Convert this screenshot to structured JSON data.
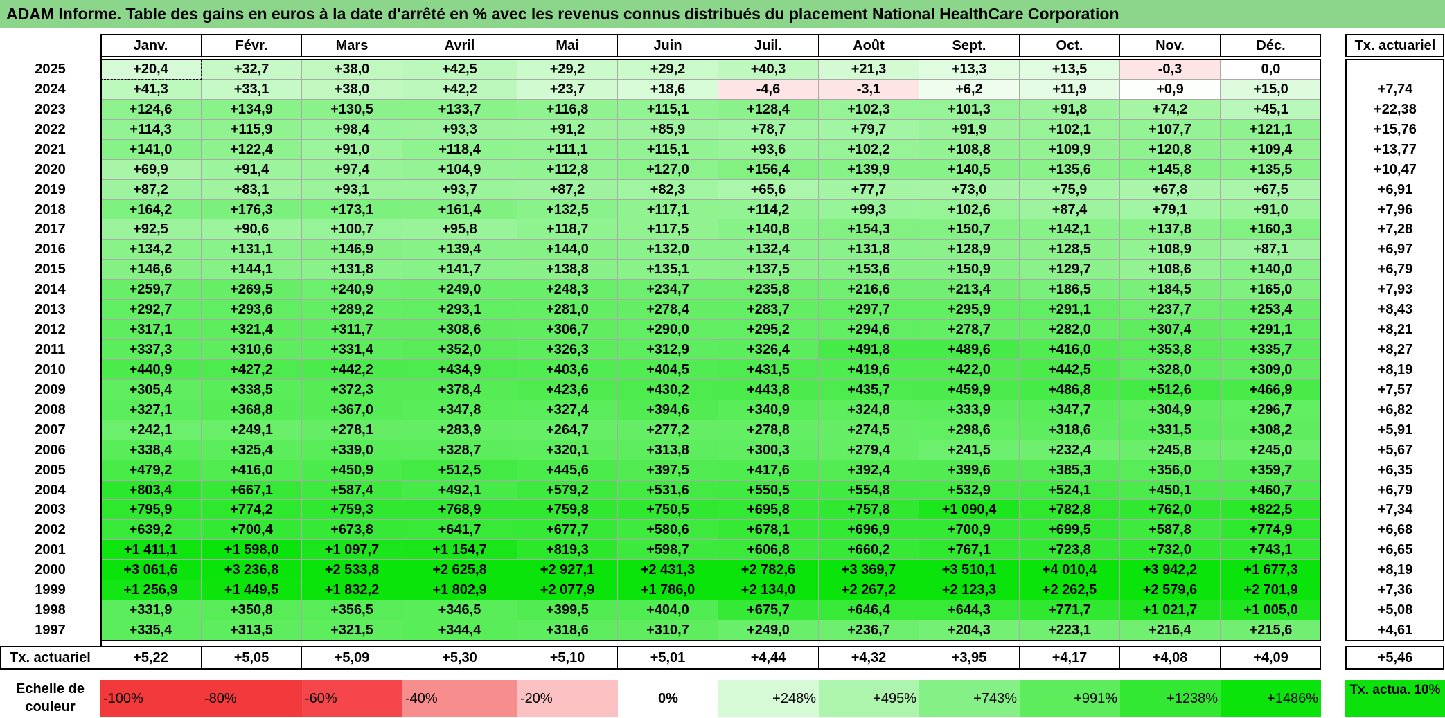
{
  "title": "ADAM Informe. Table des gains en euros à la date d'arrêté en % avec les revenus connus distribués du placement National HealthCare Corporation",
  "chart_data": {
    "type": "heatmap",
    "title": "ADAM Informe. Table des gains en euros à la date d'arrêté en % avec les revenus connus distribués du placement National HealthCare Corporation",
    "columns": [
      "Janv.",
      "Févr.",
      "Mars",
      "Avril",
      "Mai",
      "Juin",
      "Juil.",
      "Août",
      "Sept.",
      "Oct.",
      "Nov.",
      "Déc."
    ],
    "rate_header": "Tx. actuariel",
    "rows": [
      {
        "year": "2025",
        "values": [
          "+20,4",
          "+32,7",
          "+38,0",
          "+42,5",
          "+29,2",
          "+29,2",
          "+40,3",
          "+21,3",
          "+13,3",
          "+13,5",
          "-0,3",
          "0,0"
        ],
        "rate": ""
      },
      {
        "year": "2024",
        "values": [
          "+41,3",
          "+33,1",
          "+38,0",
          "+42,2",
          "+23,7",
          "+18,6",
          "-4,6",
          "-3,1",
          "+6,2",
          "+11,9",
          "+0,9",
          "+15,0"
        ],
        "rate": "+7,74"
      },
      {
        "year": "2023",
        "values": [
          "+124,6",
          "+134,9",
          "+130,5",
          "+133,7",
          "+116,8",
          "+115,1",
          "+128,4",
          "+102,3",
          "+101,3",
          "+91,8",
          "+74,2",
          "+45,1"
        ],
        "rate": "+22,38"
      },
      {
        "year": "2022",
        "values": [
          "+114,3",
          "+115,9",
          "+98,4",
          "+93,3",
          "+91,2",
          "+85,9",
          "+78,7",
          "+79,7",
          "+91,9",
          "+102,1",
          "+107,7",
          "+121,1"
        ],
        "rate": "+15,76"
      },
      {
        "year": "2021",
        "values": [
          "+141,0",
          "+122,4",
          "+91,0",
          "+118,4",
          "+111,1",
          "+115,1",
          "+93,6",
          "+102,2",
          "+108,8",
          "+109,9",
          "+120,8",
          "+109,4"
        ],
        "rate": "+13,77"
      },
      {
        "year": "2020",
        "values": [
          "+69,9",
          "+91,4",
          "+97,4",
          "+104,9",
          "+112,8",
          "+127,0",
          "+156,4",
          "+139,9",
          "+140,5",
          "+135,6",
          "+145,8",
          "+135,5"
        ],
        "rate": "+10,47"
      },
      {
        "year": "2019",
        "values": [
          "+87,2",
          "+83,1",
          "+93,1",
          "+93,7",
          "+87,2",
          "+82,3",
          "+65,6",
          "+77,7",
          "+73,0",
          "+75,9",
          "+67,8",
          "+67,5"
        ],
        "rate": "+6,91"
      },
      {
        "year": "2018",
        "values": [
          "+164,2",
          "+176,3",
          "+173,1",
          "+161,4",
          "+132,5",
          "+117,1",
          "+114,2",
          "+99,3",
          "+102,6",
          "+87,4",
          "+79,1",
          "+91,0"
        ],
        "rate": "+7,96"
      },
      {
        "year": "2017",
        "values": [
          "+92,5",
          "+90,6",
          "+100,7",
          "+95,8",
          "+118,7",
          "+117,5",
          "+140,8",
          "+154,3",
          "+150,7",
          "+142,1",
          "+137,8",
          "+160,3"
        ],
        "rate": "+7,28"
      },
      {
        "year": "2016",
        "values": [
          "+134,2",
          "+131,1",
          "+146,9",
          "+139,4",
          "+144,0",
          "+132,0",
          "+132,4",
          "+131,8",
          "+128,9",
          "+128,5",
          "+108,9",
          "+87,1"
        ],
        "rate": "+6,97"
      },
      {
        "year": "2015",
        "values": [
          "+146,6",
          "+144,1",
          "+131,8",
          "+141,7",
          "+138,8",
          "+135,1",
          "+137,5",
          "+153,6",
          "+150,9",
          "+129,7",
          "+108,6",
          "+140,0"
        ],
        "rate": "+6,79"
      },
      {
        "year": "2014",
        "values": [
          "+259,7",
          "+269,5",
          "+240,9",
          "+249,0",
          "+248,3",
          "+234,7",
          "+235,8",
          "+216,6",
          "+213,4",
          "+186,5",
          "+184,5",
          "+165,0"
        ],
        "rate": "+7,93"
      },
      {
        "year": "2013",
        "values": [
          "+292,7",
          "+293,6",
          "+289,2",
          "+293,1",
          "+281,0",
          "+278,4",
          "+283,7",
          "+297,7",
          "+295,9",
          "+291,1",
          "+237,7",
          "+253,4"
        ],
        "rate": "+8,43"
      },
      {
        "year": "2012",
        "values": [
          "+317,1",
          "+321,4",
          "+311,7",
          "+308,6",
          "+306,7",
          "+290,0",
          "+295,2",
          "+294,6",
          "+278,7",
          "+282,0",
          "+307,4",
          "+291,1"
        ],
        "rate": "+8,21"
      },
      {
        "year": "2011",
        "values": [
          "+337,3",
          "+310,6",
          "+331,4",
          "+352,0",
          "+326,3",
          "+312,9",
          "+326,4",
          "+491,8",
          "+489,6",
          "+416,0",
          "+353,8",
          "+335,7"
        ],
        "rate": "+8,27"
      },
      {
        "year": "2010",
        "values": [
          "+440,9",
          "+427,2",
          "+442,2",
          "+434,9",
          "+403,6",
          "+404,5",
          "+431,5",
          "+419,6",
          "+422,0",
          "+442,5",
          "+328,0",
          "+309,0"
        ],
        "rate": "+8,19"
      },
      {
        "year": "2009",
        "values": [
          "+305,4",
          "+338,5",
          "+372,3",
          "+378,4",
          "+423,6",
          "+430,2",
          "+443,8",
          "+435,7",
          "+459,9",
          "+486,8",
          "+512,6",
          "+466,9"
        ],
        "rate": "+7,57"
      },
      {
        "year": "2008",
        "values": [
          "+327,1",
          "+368,8",
          "+367,0",
          "+347,8",
          "+327,4",
          "+394,6",
          "+340,9",
          "+324,8",
          "+333,9",
          "+347,7",
          "+304,9",
          "+296,7"
        ],
        "rate": "+6,82"
      },
      {
        "year": "2007",
        "values": [
          "+242,1",
          "+249,1",
          "+278,1",
          "+283,9",
          "+264,7",
          "+277,2",
          "+278,8",
          "+274,5",
          "+298,6",
          "+318,6",
          "+331,5",
          "+308,2"
        ],
        "rate": "+5,91"
      },
      {
        "year": "2006",
        "values": [
          "+338,4",
          "+325,4",
          "+339,0",
          "+328,7",
          "+320,1",
          "+313,8",
          "+300,3",
          "+279,4",
          "+241,5",
          "+232,4",
          "+245,8",
          "+245,0"
        ],
        "rate": "+5,67"
      },
      {
        "year": "2005",
        "values": [
          "+479,2",
          "+416,0",
          "+450,9",
          "+512,5",
          "+445,6",
          "+397,5",
          "+417,6",
          "+392,4",
          "+399,6",
          "+385,3",
          "+356,0",
          "+359,7"
        ],
        "rate": "+6,35"
      },
      {
        "year": "2004",
        "values": [
          "+803,4",
          "+667,1",
          "+587,4",
          "+492,1",
          "+579,2",
          "+531,6",
          "+550,5",
          "+554,8",
          "+532,9",
          "+524,1",
          "+450,1",
          "+460,7"
        ],
        "rate": "+6,79"
      },
      {
        "year": "2003",
        "values": [
          "+795,9",
          "+774,2",
          "+759,3",
          "+768,9",
          "+759,8",
          "+750,5",
          "+695,8",
          "+757,8",
          "+1 090,4",
          "+782,8",
          "+762,0",
          "+822,5"
        ],
        "rate": "+7,34"
      },
      {
        "year": "2002",
        "values": [
          "+639,2",
          "+700,4",
          "+673,8",
          "+641,7",
          "+677,7",
          "+580,6",
          "+678,1",
          "+696,9",
          "+700,9",
          "+699,5",
          "+587,8",
          "+774,9"
        ],
        "rate": "+6,68"
      },
      {
        "year": "2001",
        "values": [
          "+1 411,1",
          "+1 598,0",
          "+1 097,7",
          "+1 154,7",
          "+819,3",
          "+598,7",
          "+606,8",
          "+660,2",
          "+767,1",
          "+723,8",
          "+732,0",
          "+743,1"
        ],
        "rate": "+6,65"
      },
      {
        "year": "2000",
        "values": [
          "+3 061,6",
          "+3 236,8",
          "+2 533,8",
          "+2 625,8",
          "+2 927,1",
          "+2 431,3",
          "+2 782,6",
          "+3 369,7",
          "+3 510,1",
          "+4 010,4",
          "+3 942,2",
          "+1 677,3"
        ],
        "rate": "+8,19"
      },
      {
        "year": "1999",
        "values": [
          "+1 256,9",
          "+1 449,5",
          "+1 832,2",
          "+1 802,9",
          "+2 077,9",
          "+1 786,0",
          "+2 134,0",
          "+2 267,2",
          "+2 123,3",
          "+2 262,5",
          "+2 579,6",
          "+2 701,9"
        ],
        "rate": "+7,36"
      },
      {
        "year": "1998",
        "values": [
          "+331,9",
          "+350,8",
          "+356,5",
          "+346,5",
          "+399,5",
          "+404,0",
          "+675,7",
          "+646,4",
          "+644,3",
          "+771,7",
          "+1 021,7",
          "+1 005,0"
        ],
        "rate": "+5,08"
      },
      {
        "year": "1997",
        "values": [
          "+335,4",
          "+313,5",
          "+321,5",
          "+344,4",
          "+318,6",
          "+310,7",
          "+249,0",
          "+236,7",
          "+204,3",
          "+223,1",
          "+216,4",
          "+215,6"
        ],
        "rate": "+4,61"
      }
    ],
    "summary_row": {
      "label": "Tx. actuariel",
      "values": [
        "+5,22",
        "+5,05",
        "+5,09",
        "+5,30",
        "+5,10",
        "+5,01",
        "+4,44",
        "+4,32",
        "+3,95",
        "+4,17",
        "+4,08",
        "+4,09"
      ],
      "rate": "+5,46"
    },
    "color_scale": {
      "label": "Echelle de couleur",
      "steps": [
        {
          "text": "-100%",
          "color": "#f2393c",
          "align": "left"
        },
        {
          "text": "-80%",
          "color": "#f2393c",
          "align": "left"
        },
        {
          "text": "-60%",
          "color": "#f5474b",
          "align": "left"
        },
        {
          "text": "-40%",
          "color": "#f88d8e",
          "align": "left"
        },
        {
          "text": "-20%",
          "color": "#fcc2c3",
          "align": "left"
        },
        {
          "text": "0%",
          "color": "#ffffff",
          "align": "center"
        },
        {
          "text": "+248%",
          "color": "#d6f9d6",
          "align": "right"
        },
        {
          "text": "+495%",
          "color": "#adf5ad",
          "align": "right"
        },
        {
          "text": "+743%",
          "color": "#85f085",
          "align": "right"
        },
        {
          "text": "+991%",
          "color": "#5cec5c",
          "align": "right"
        },
        {
          "text": "+1238%",
          "color": "#33e833",
          "align": "right"
        },
        {
          "text": "+1486%",
          "color": "#0be40b",
          "align": "right"
        }
      ],
      "actua_label": "Tx. actua. 10%",
      "actua_color": "#0ce10c"
    }
  }
}
